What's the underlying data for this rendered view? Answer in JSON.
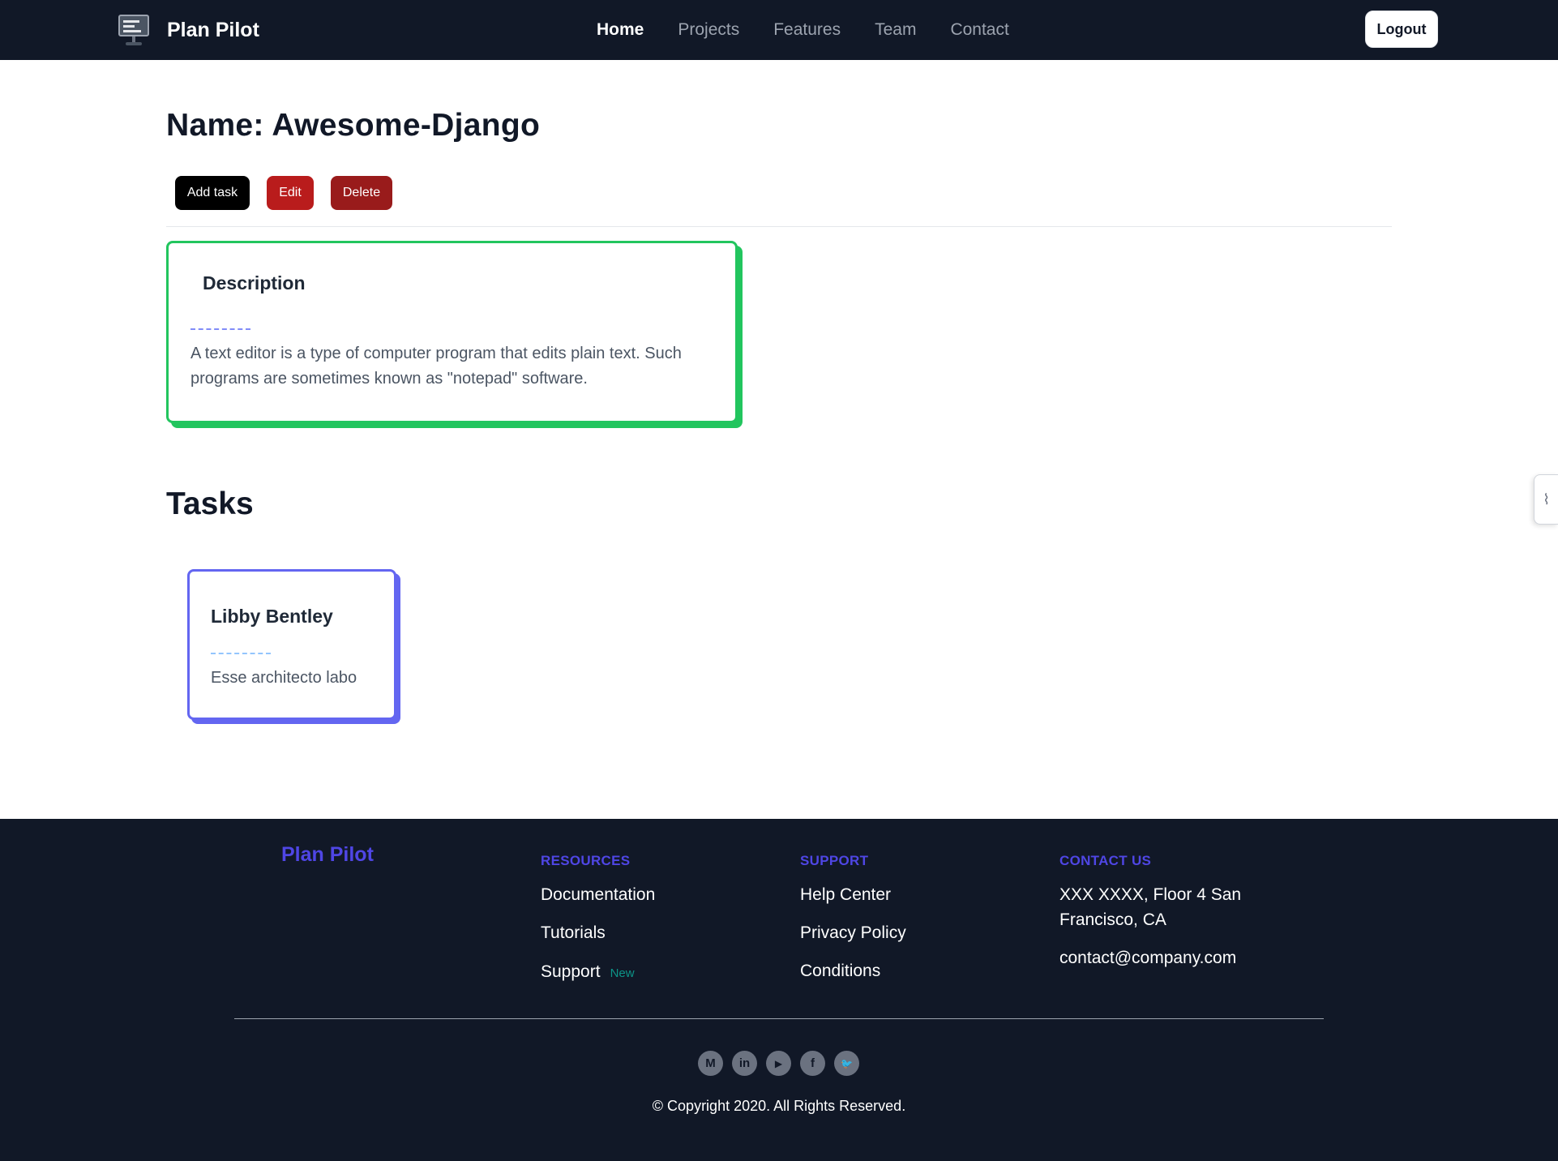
{
  "navbar": {
    "brand": "Plan Pilot",
    "links": [
      "Home",
      "Projects",
      "Features",
      "Team",
      "Contact"
    ],
    "active": "Home",
    "logout_label": "Logout"
  },
  "project": {
    "title": "Name: Awesome-Django",
    "actions": {
      "add_task": "Add task",
      "edit": "Edit",
      "delete": "Delete"
    },
    "description": {
      "heading": "Description",
      "separator": "-----------",
      "text": "A text editor is a type of computer program that edits plain text. Such programs are sometimes known as \"notepad\" software."
    }
  },
  "tasks": {
    "heading": "Tasks",
    "items": [
      {
        "name": "Libby Bentley",
        "separator": "-----------",
        "text": "Esse architecto labo"
      }
    ]
  },
  "footer": {
    "brand": "Plan Pilot",
    "resources": {
      "heading": "RESOURCES",
      "links": [
        "Documentation",
        "Tutorials",
        "Support"
      ],
      "badge": "New"
    },
    "support": {
      "heading": "SUPPORT",
      "links": [
        "Help Center",
        "Privacy Policy",
        "Conditions"
      ]
    },
    "contact": {
      "heading": "CONTACT US",
      "address_line1": "XXX XXXX, Floor 4 San",
      "address_line2": "Francisco, CA",
      "email": "contact@company.com"
    },
    "socials": [
      {
        "icon": "medium-icon",
        "glyph": "M"
      },
      {
        "icon": "linkedin-icon",
        "glyph": "in"
      },
      {
        "icon": "youtube-icon",
        "glyph": "▶"
      },
      {
        "icon": "facebook-icon",
        "glyph": "f"
      },
      {
        "icon": "twitter-icon",
        "glyph": "🐦"
      }
    ],
    "copyright": "© Copyright 2020. All Rights Reserved."
  },
  "colors": {
    "navbar_bg": "#111827",
    "accent_indigo": "#4f46e5",
    "description_border": "#22c55e",
    "task_border": "#6366f1",
    "edit_button": "#b91c1c",
    "delete_button": "#991b1b",
    "new_badge": "#0d9488"
  }
}
